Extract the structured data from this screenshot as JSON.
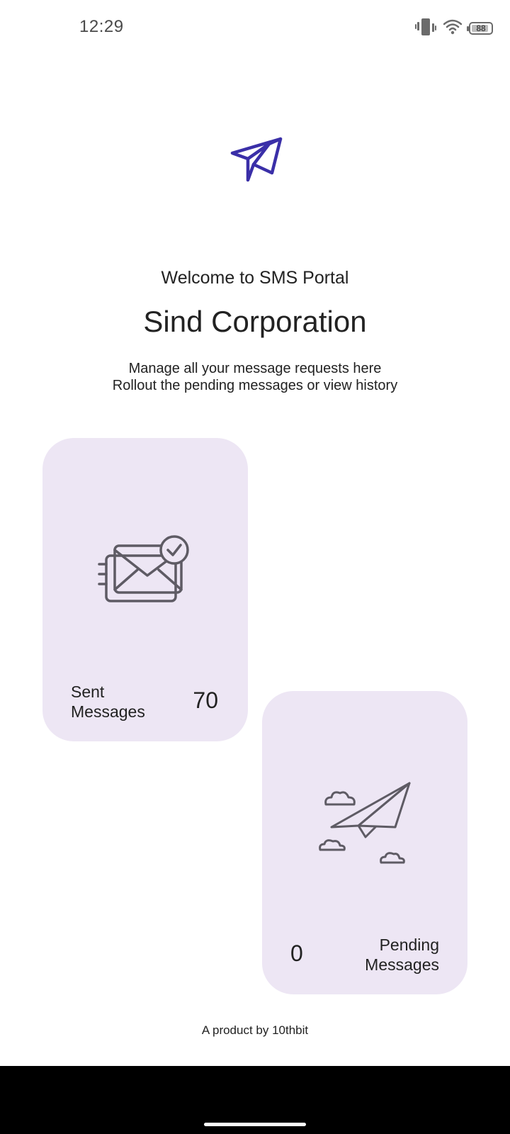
{
  "status_bar": {
    "time": "12:29",
    "battery": "88",
    "battery_level": 0.88,
    "icons": [
      "vibrate-icon",
      "wifi-icon",
      "battery-icon"
    ]
  },
  "header": {
    "logo_icon": "paper-plane-icon",
    "welcome": "Welcome to SMS Portal",
    "org_name": "Sind Corporation",
    "subtitle_line1": "Manage all your message requests here",
    "subtitle_line2": "Rollout the pending messages or view history"
  },
  "cards": {
    "sent": {
      "label_line1": "Sent",
      "label_line2": "Messages",
      "count": "70",
      "icon": "sent-envelope-icon"
    },
    "pending": {
      "label_line1": "Pending",
      "label_line2": "Messages",
      "count": "0",
      "icon": "paper-plane-clouds-icon"
    }
  },
  "footer": {
    "text": "A product by 10thbit"
  },
  "colors": {
    "accent": "#3a2fa8",
    "card_background": "#ede6f4",
    "icon_stroke": "#5e5b64"
  }
}
